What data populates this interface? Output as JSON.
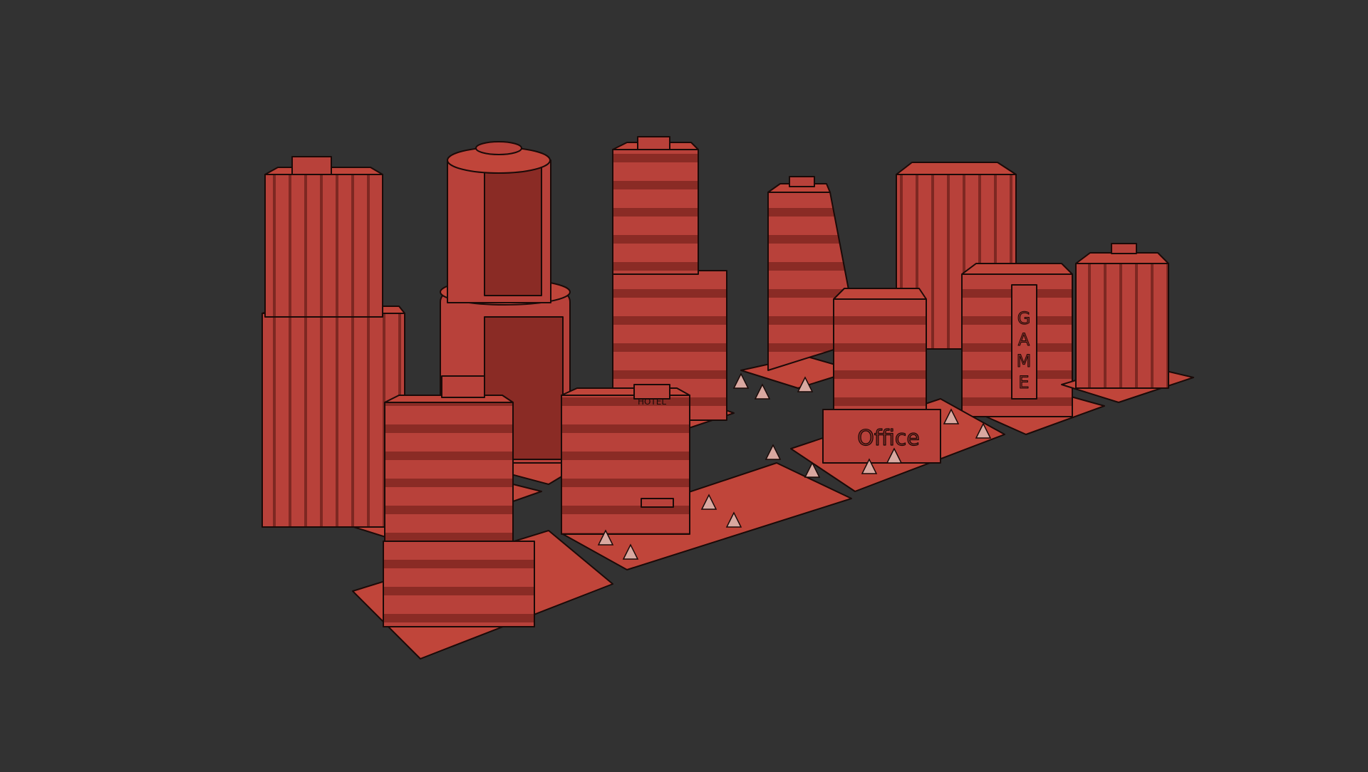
{
  "scene": {
    "background_color": "#323232",
    "model_fill": "#c0453a",
    "model_shade": "#a8382f",
    "model_dark": "#8e2e27",
    "wire_color": "#1a0a08",
    "tree_color": "#d9a8a0"
  },
  "signs": {
    "hotel": "HOTEL",
    "office": "Office",
    "game": [
      "G",
      "A",
      "M",
      "E"
    ]
  }
}
